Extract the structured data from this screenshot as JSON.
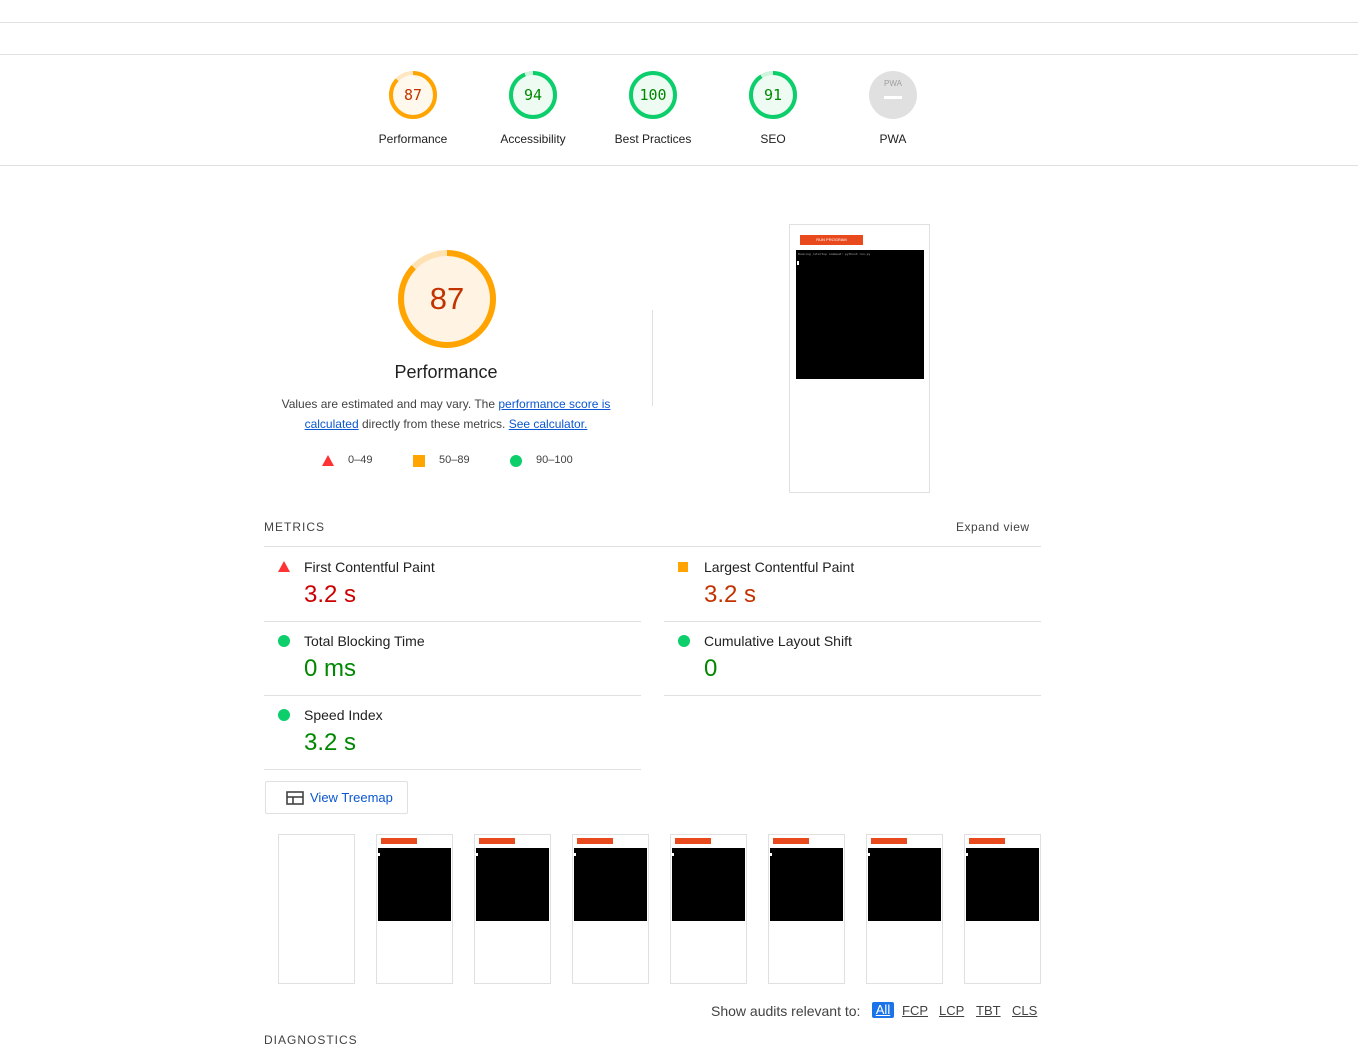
{
  "gauges": [
    {
      "score": "87",
      "label": "Performance",
      "color": "#ffa400",
      "text_color": "#c33300",
      "fraction": 0.87
    },
    {
      "score": "94",
      "label": "Accessibility",
      "color": "#0cce6b",
      "text_color": "#008800",
      "fraction": 0.94
    },
    {
      "score": "100",
      "label": "Best Practices",
      "color": "#0cce6b",
      "text_color": "#008800",
      "fraction": 1.0
    },
    {
      "score": "91",
      "label": "SEO",
      "color": "#0cce6b",
      "text_color": "#008800",
      "fraction": 0.91
    },
    {
      "score": "PWA",
      "label": "PWA",
      "color": "#e0e0e0",
      "text_color": "#9e9e9e",
      "fraction": 0
    }
  ],
  "perf": {
    "score": "87",
    "title": "Performance",
    "desc_pre": "Values are estimated and may vary. The ",
    "desc_link": "performance score is calculated",
    "desc_mid": " directly from these metrics. ",
    "desc_link2": "See calculator.",
    "legend": [
      "0–49",
      "50–89",
      "90–100"
    ]
  },
  "screenshot": {
    "button_label": "RUN PROGRAM",
    "terminal_line": "Running /startup command: python3 run.py"
  },
  "metrics_header": {
    "title": "METRICS",
    "expand": "Expand view"
  },
  "metrics": [
    {
      "name": "First Contentful Paint",
      "value": "3.2 s",
      "status": "fail"
    },
    {
      "name": "Largest Contentful Paint",
      "value": "3.2 s",
      "status": "average"
    },
    {
      "name": "Total Blocking Time",
      "value": "0 ms",
      "status": "pass"
    },
    {
      "name": "Cumulative Layout Shift",
      "value": "0",
      "status": "pass"
    },
    {
      "name": "Speed Index",
      "value": "3.2 s",
      "status": "pass"
    }
  ],
  "treemap_label": "View Treemap",
  "filter": {
    "label": "Show audits relevant to:",
    "options": [
      "All",
      "FCP",
      "LCP",
      "TBT",
      "CLS"
    ]
  },
  "diagnostics": "DIAGNOSTICS"
}
